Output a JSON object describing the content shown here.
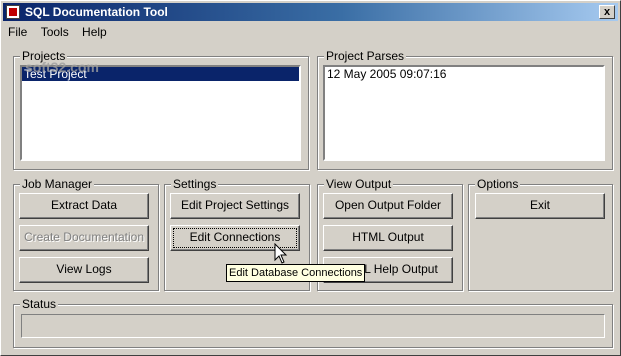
{
  "window": {
    "title": "SQL Documentation Tool",
    "close_label": "x"
  },
  "menu": {
    "items": [
      "File",
      "Tools",
      "Help"
    ]
  },
  "projects": {
    "label": "Projects",
    "items": [
      "Test Project"
    ]
  },
  "parses": {
    "label": "Project Parses",
    "items": [
      "12 May 2005 09:07:16"
    ]
  },
  "job_manager": {
    "label": "Job Manager",
    "extract": "Extract Data",
    "create": "Create Documentation",
    "logs": "View Logs"
  },
  "settings": {
    "label": "Settings",
    "project_settings": "Edit Project Settings",
    "connections": "Edit Connections"
  },
  "view_output": {
    "label": "View Output",
    "open_folder": "Open Output Folder",
    "html": "HTML Output",
    "html_help": "HTML Help Output"
  },
  "options": {
    "label": "Options",
    "exit": "Exit"
  },
  "status": {
    "label": "Status",
    "value": ""
  },
  "tooltip": {
    "text": "Edit Database Connections"
  },
  "watermark": {
    "text": "soft32.com"
  },
  "colors": {
    "title_start": "#0a246a",
    "selection": "#0a246a",
    "tooltip_bg": "#ffffe1"
  }
}
